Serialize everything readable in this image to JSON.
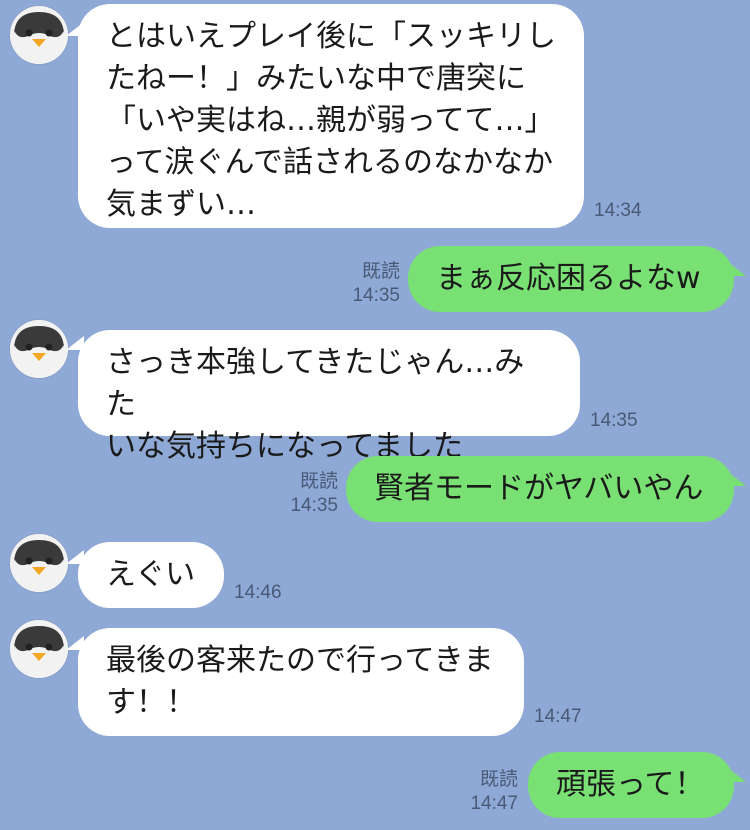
{
  "messages": [
    {
      "side": "in",
      "text": "とはいえプレイ後に「スッキリし\nたねー！」みたいな中で唐突に\n「いや実はね…親が弱ってて…」\nって涙ぐんで話されるのなかなか\n気まずい…",
      "time": "14:34"
    },
    {
      "side": "out",
      "text": "まぁ反応困るよなw",
      "read": "既読",
      "time": "14:35"
    },
    {
      "side": "in",
      "text": "さっき本強してきたじゃん…みた\nいな気持ちになってました",
      "time": "14:35"
    },
    {
      "side": "out",
      "text": "賢者モードがヤバいやん",
      "read": "既読",
      "time": "14:35"
    },
    {
      "side": "in",
      "text": "えぐい",
      "time": "14:46"
    },
    {
      "side": "in",
      "text": "最後の客来たので行ってきま\nす！！",
      "time": "14:47"
    },
    {
      "side": "out",
      "text": "頑張って！",
      "read": "既読",
      "time": "14:47"
    }
  ],
  "colors": {
    "background": "#8fa9d6",
    "incoming_bubble": "#ffffff",
    "outgoing_bubble": "#79e073"
  },
  "avatar_icon": "penguin-icon"
}
